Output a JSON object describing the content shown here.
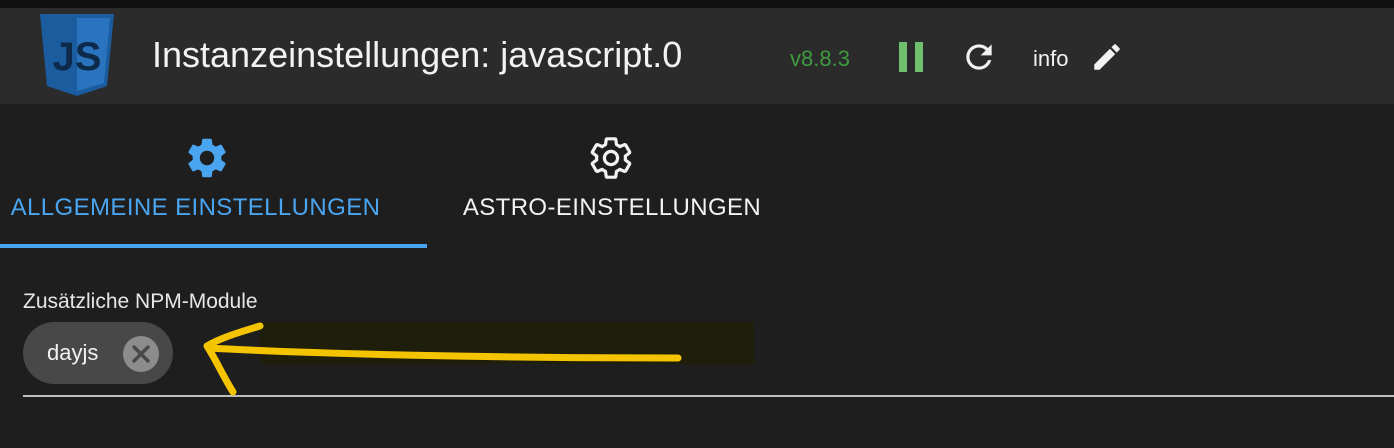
{
  "header": {
    "logo_text": "JS",
    "title": "Instanzeinstellungen: javascript.0",
    "version": "v8.8.3",
    "info_label": "info",
    "colors": {
      "version": "#3f9b3f",
      "pause": "#6ec06e",
      "logo": "#1a5c9e"
    },
    "icons": [
      "javascript-logo",
      "pause-icon",
      "reload-icon",
      "pencil-icon"
    ]
  },
  "tabs": [
    {
      "label": "ALLGEMEINE EINSTELLUNGEN",
      "icon": "gear-icon",
      "active": true
    },
    {
      "label": "ASTRO-EINSTELLUNGEN",
      "icon": "gear-outline-icon",
      "active": false
    }
  ],
  "accent_color": "#4aa5f0",
  "npm_field": {
    "label": "Zusätzliche NPM-Module",
    "chips": [
      {
        "label": "dayjs",
        "delete_icon": "close-circle-icon"
      }
    ]
  },
  "annotation": {
    "arrow_color": "#f5c400"
  }
}
